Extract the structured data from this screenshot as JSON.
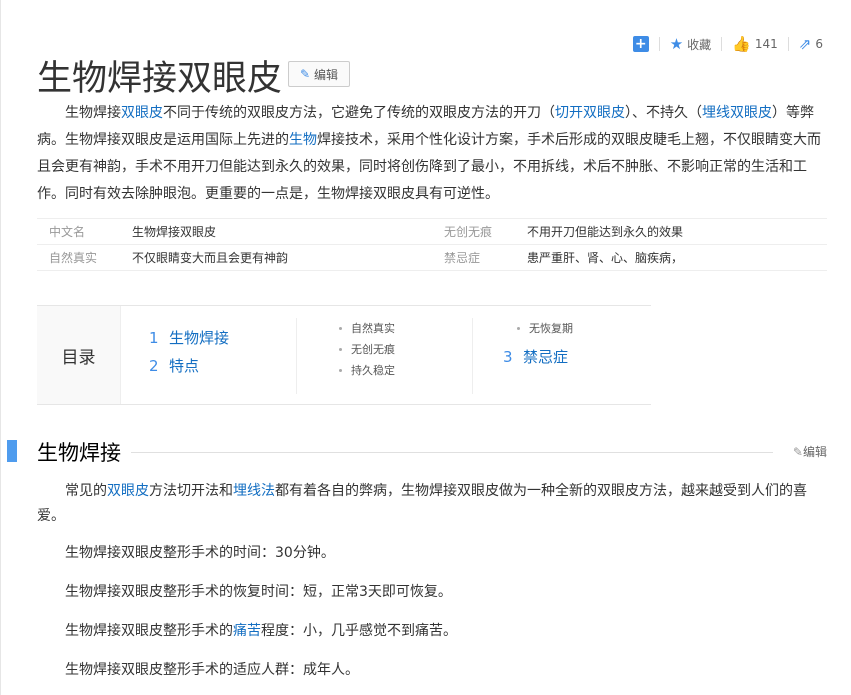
{
  "tools": {
    "collect_label": "收藏",
    "like_count": "141",
    "share_count": "6"
  },
  "title": "生物焊接双眼皮",
  "edit_label": "编辑",
  "summary": {
    "p1": "生物焊接",
    "link1": "双眼皮",
    "p2": "不同于传统的双眼皮方法，它避免了传统的双眼皮方法的开刀（",
    "link2": "切开双眼皮",
    "p3": "）、不持久（",
    "link3": "埋线双眼皮",
    "p4": "）等弊病。生物焊接双眼皮是运用国际上先进的",
    "link4": "生物",
    "p5": "焊接技术，采用个性化设计方案，手术后形成的双眼皮睫毛上翘，不仅眼睛变大而且会更有神韵，手术不用开刀但能达到永久的效果，同时将创伤降到了最小，不用拆线，术后不肿胀、不影响正常的生活和工作。同时有效去除肿眼泡。更重要的一点是，生物焊接双眼皮具有可逆性。"
  },
  "basic_info": [
    {
      "k1": "中文名",
      "v1": "生物焊接双眼皮",
      "k2": "无创无痕",
      "v2": "不用开刀但能达到永久的效果"
    },
    {
      "k1": "自然真实",
      "v1": "不仅眼睛变大而且会更有神韵",
      "k2": "禁忌症",
      "v2": "患严重肝、肾、心、脑疾病，"
    }
  ],
  "toc": {
    "label": "目录",
    "items": [
      {
        "num": "1",
        "text": "生物焊接"
      },
      {
        "num": "2",
        "text": "特点"
      },
      {
        "num": "3",
        "text": "禁忌症"
      }
    ],
    "sub_col2": [
      "自然真实",
      "无创无痕",
      "持久稳定"
    ],
    "sub_col3": [
      "无恢复期"
    ]
  },
  "section1": {
    "title": "生物焊接",
    "edit_label": "编辑",
    "p1_a": "常见的",
    "p1_link1": "双眼皮",
    "p1_b": "方法切开法和",
    "p1_link2": "埋线法",
    "p1_c": "都有着各自的弊病，生物焊接双眼皮做为一种全新的双眼皮方法，越来越受到人们的喜爱。",
    "p2": "生物焊接双眼皮整形手术的时间：30分钟。",
    "p3": "生物焊接双眼皮整形手术的恢复时间：短，正常3天即可恢复。",
    "p4_a": "生物焊接双眼皮整形手术的",
    "p4_link": "痛苦",
    "p4_b": "程度：小，几乎感觉不到痛苦。",
    "p5": "生物焊接双眼皮整形手术的适应人群：成年人。"
  }
}
